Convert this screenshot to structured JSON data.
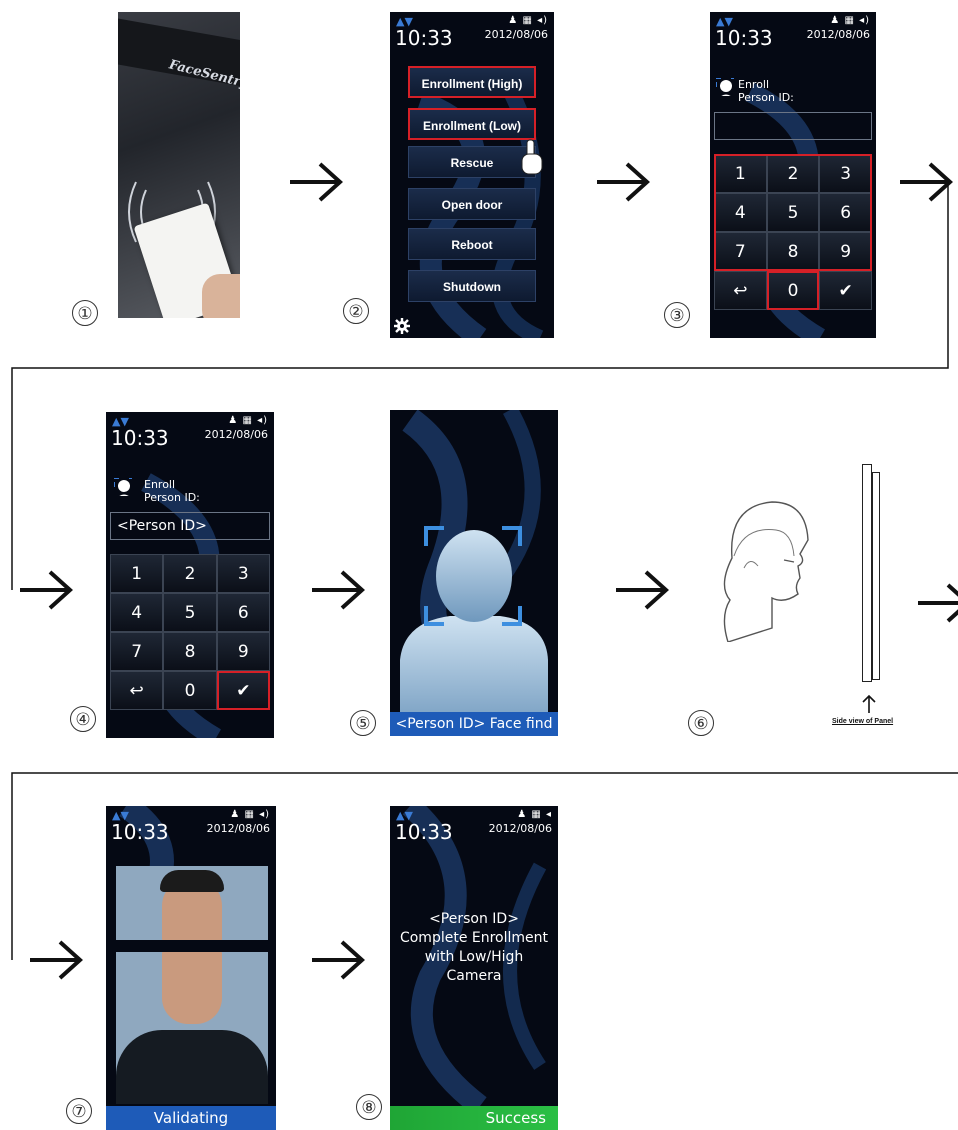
{
  "steps": {
    "s1": {
      "num": "①",
      "card_brand": "FaceSentry"
    },
    "s2": {
      "num": "②",
      "status": {
        "signal": "▲▼",
        "icons": "♟ ▦ ◂)",
        "time": "10:33",
        "date": "2012/08/06"
      },
      "menu": [
        "Enrollment (High)",
        "Enrollment (Low)",
        "Rescue",
        "Open door",
        "Reboot",
        "Shutdown"
      ]
    },
    "s3": {
      "num": "③",
      "status": {
        "signal": "▲▼",
        "icons": "♟ ▦ ◂)",
        "time": "10:33",
        "date": "2012/08/06"
      },
      "enroll": "Enroll",
      "person_id_label": "Person ID:",
      "id_value": "",
      "keys": [
        "1",
        "2",
        "3",
        "4",
        "5",
        "6",
        "7",
        "8",
        "9",
        "↩",
        "0",
        "✔"
      ]
    },
    "s4": {
      "num": "④",
      "status": {
        "signal": "▲▼",
        "icons": "♟ ▦ ◂)",
        "time": "10:33",
        "date": "2012/08/06"
      },
      "enroll": "Enroll",
      "person_id_label": "Person ID:",
      "id_value": "<Person ID>",
      "keys": [
        "1",
        "2",
        "3",
        "4",
        "5",
        "6",
        "7",
        "8",
        "9",
        "↩",
        "0",
        "✔"
      ]
    },
    "s5": {
      "num": "⑤",
      "banner": "<Person ID> Face find"
    },
    "s6": {
      "num": "⑥",
      "panel_caption": "Side view of Panel"
    },
    "s7": {
      "num": "⑦",
      "status": {
        "signal": "▲▼",
        "icons": "♟ ▦ ◂)",
        "time": "10:33",
        "date": "2012/08/06"
      },
      "banner": "Validating"
    },
    "s8": {
      "num": "⑧",
      "status": {
        "signal": "▲▼",
        "icons": "♟ ▦ ◂",
        "time": "10:33",
        "date": "2012/08/06"
      },
      "message": [
        "<Person ID>",
        "Complete Enrollment",
        "with Low/High",
        "Camera"
      ],
      "banner": "Success"
    }
  },
  "colors": {
    "highlight": "#d62027",
    "blue_banner": "#1e5bb8",
    "green_banner": "#1fa535",
    "screen_bg": "#050914"
  }
}
